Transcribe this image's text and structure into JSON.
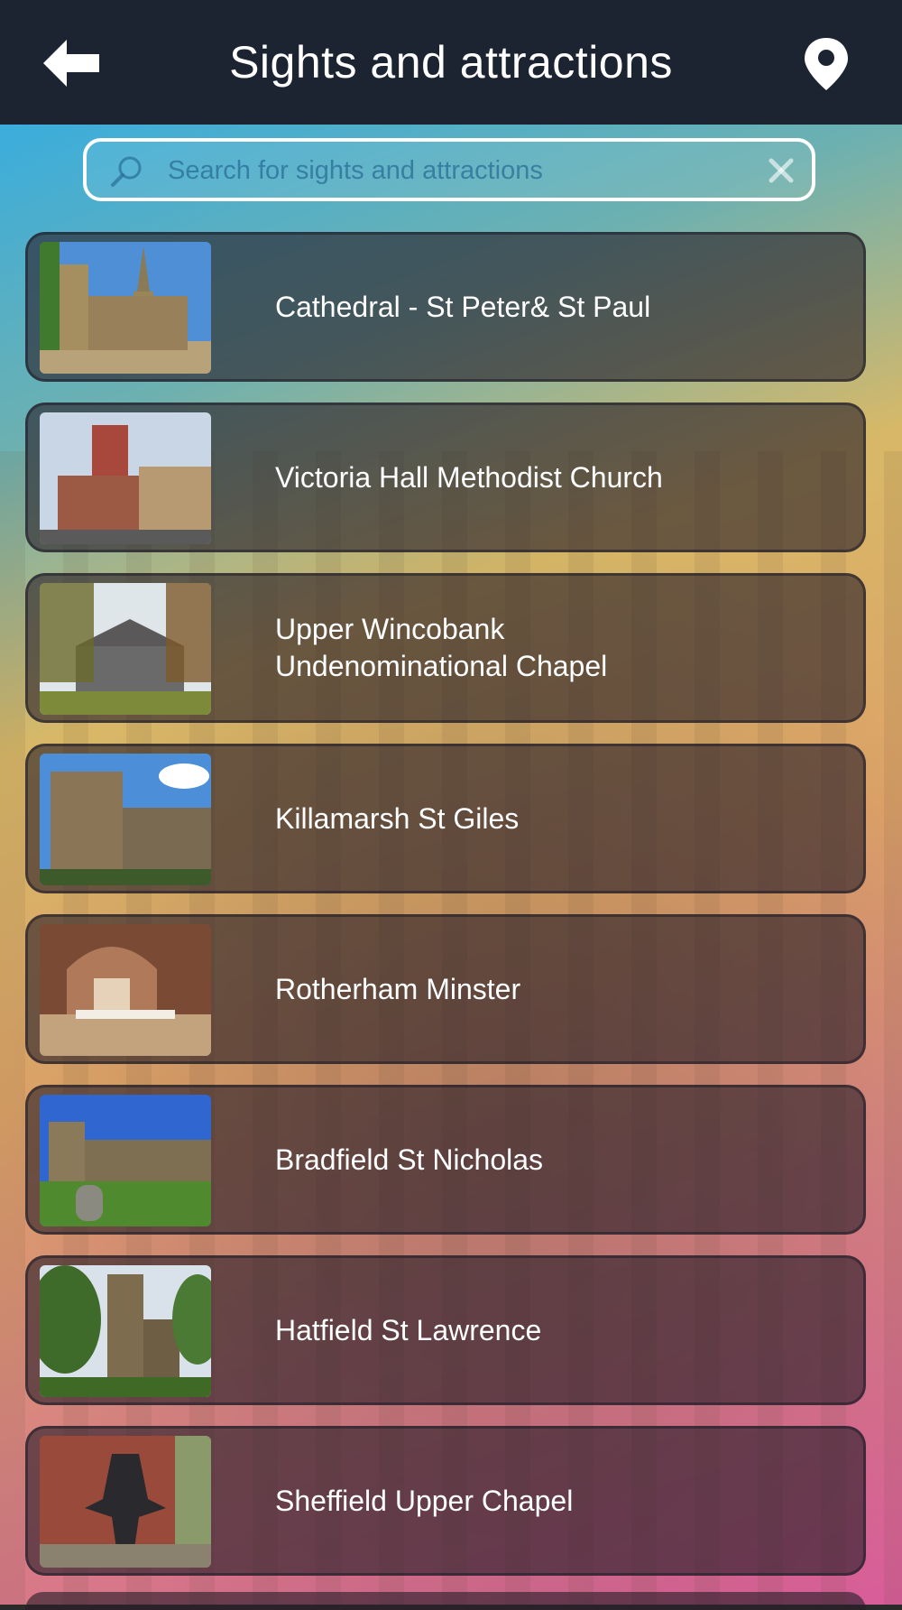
{
  "header": {
    "title": "Sights and attractions",
    "back_icon": "arrow-left-icon",
    "location_icon": "map-pin-icon",
    "background_color": "#1c2432"
  },
  "search": {
    "placeholder": "Search for sights and attractions",
    "value": "",
    "search_icon": "search-icon",
    "clear_icon": "clear-icon"
  },
  "items": [
    {
      "name": "Cathedral - St Peter& St Paul",
      "thumbnail": "cathedral-photo"
    },
    {
      "name": "Victoria Hall Methodist Church",
      "thumbnail": "church-photo"
    },
    {
      "name": "Upper Wincobank\nUndenominational Chapel",
      "thumbnail": "chapel-photo"
    },
    {
      "name": "Killamarsh St Giles",
      "thumbnail": "church-tower-photo"
    },
    {
      "name": "Rotherham Minster",
      "thumbnail": "church-interior-photo"
    },
    {
      "name": "Bradfield St Nicholas",
      "thumbnail": "church-graveyard-photo"
    },
    {
      "name": "Hatfield St Lawrence",
      "thumbnail": "church-trees-photo"
    },
    {
      "name": "Sheffield Upper Chapel",
      "thumbnail": "statue-photo"
    }
  ]
}
